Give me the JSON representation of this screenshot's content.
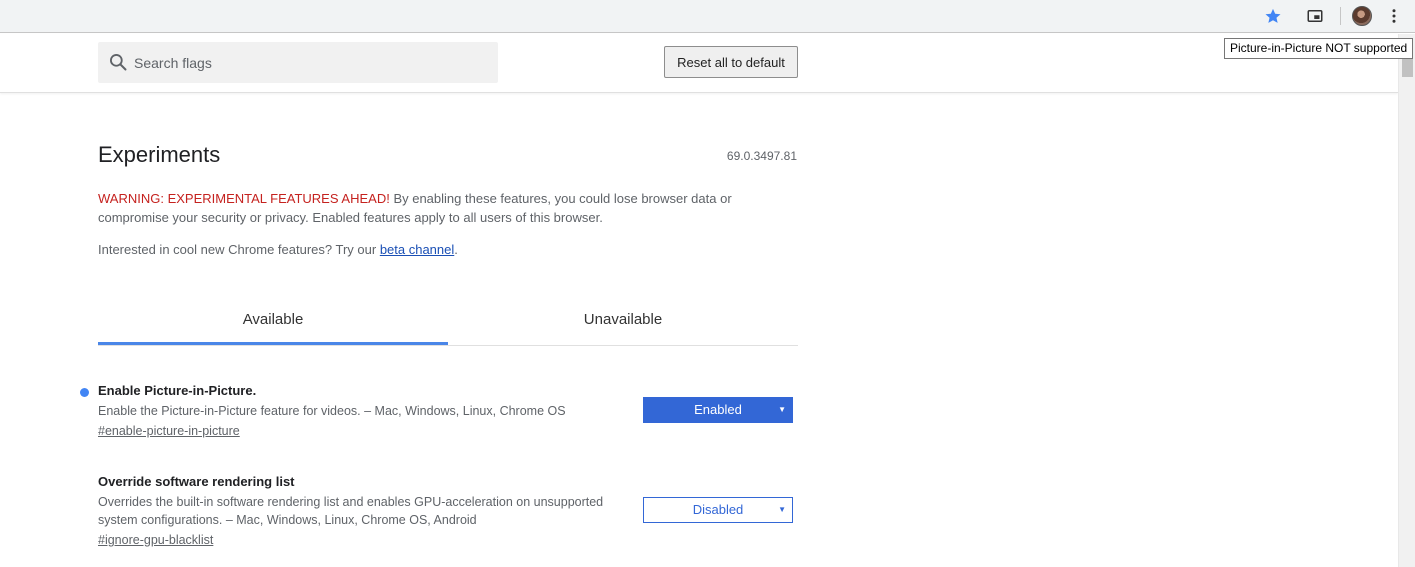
{
  "toolbar": {
    "icons": [
      "star-icon",
      "picture-in-picture-icon",
      "avatar",
      "more-vert-icon"
    ],
    "tooltip": "Picture-in-Picture NOT supported"
  },
  "header": {
    "search_placeholder": "Search flags",
    "reset_label": "Reset all to default"
  },
  "main": {
    "title": "Experiments",
    "version": "69.0.3497.81",
    "warning_red": "WARNING: EXPERIMENTAL FEATURES AHEAD!",
    "warning_text": " By enabling these features, you could lose browser data or compromise your security or privacy. Enabled features apply to all users of this browser.",
    "interest_prefix": "Interested in cool new Chrome features? Try our ",
    "interest_link": "beta channel",
    "interest_suffix": ".",
    "tabs": [
      {
        "label": "Available",
        "active": true
      },
      {
        "label": "Unavailable",
        "active": false
      }
    ]
  },
  "experiments": [
    {
      "title": "Enable Picture-in-Picture.",
      "description": "Enable the Picture-in-Picture feature for videos. – Mac, Windows, Linux, Chrome OS",
      "link": "#enable-picture-in-picture",
      "value": "Enabled",
      "modified": true
    },
    {
      "title": "Override software rendering list",
      "description": "Overrides the built-in software rendering list and enables GPU-acceleration on unsupported system configurations. – Mac, Windows, Linux, Chrome OS, Android",
      "link": "#ignore-gpu-blacklist",
      "value": "Disabled",
      "modified": false
    }
  ],
  "colors": {
    "accent": "#3367d6",
    "warning": "#c5221f",
    "tab_indicator": "#4a86e8"
  }
}
